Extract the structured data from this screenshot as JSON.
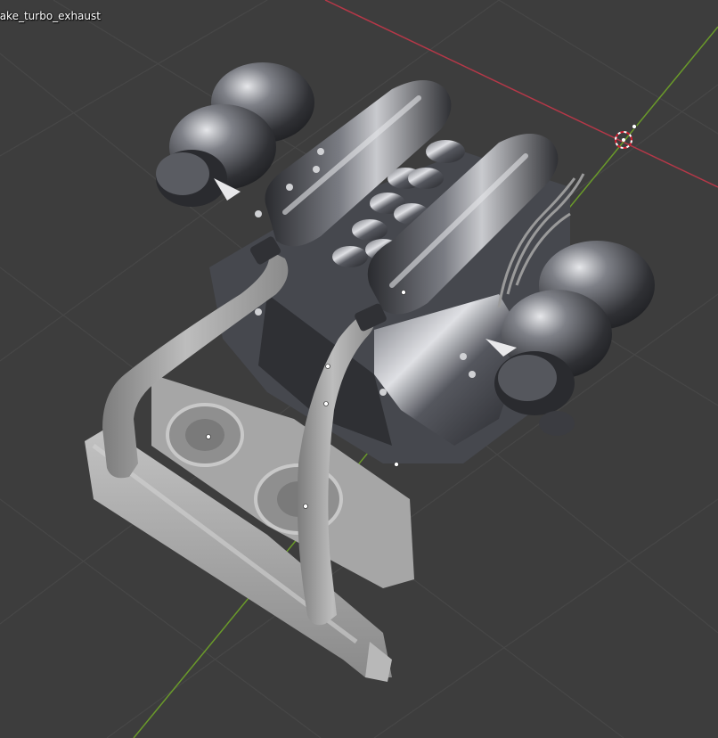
{
  "viewport": {
    "object_name": "take_turbo_exhaust",
    "background_color": "#3d3d3d",
    "grid_color": "#464646",
    "axis_x_color": "#c0394b",
    "axis_y_color": "#6e9d2c",
    "icons": {
      "origin": "3d-cursor-icon",
      "vertex": "vertex-dot-icon"
    }
  },
  "materials": {
    "metal_dark": "#4a4c52",
    "metal_highlight": "#d9dade",
    "clay_grey": "#a7a7a7",
    "clay_shadow": "#6f6f6f"
  }
}
